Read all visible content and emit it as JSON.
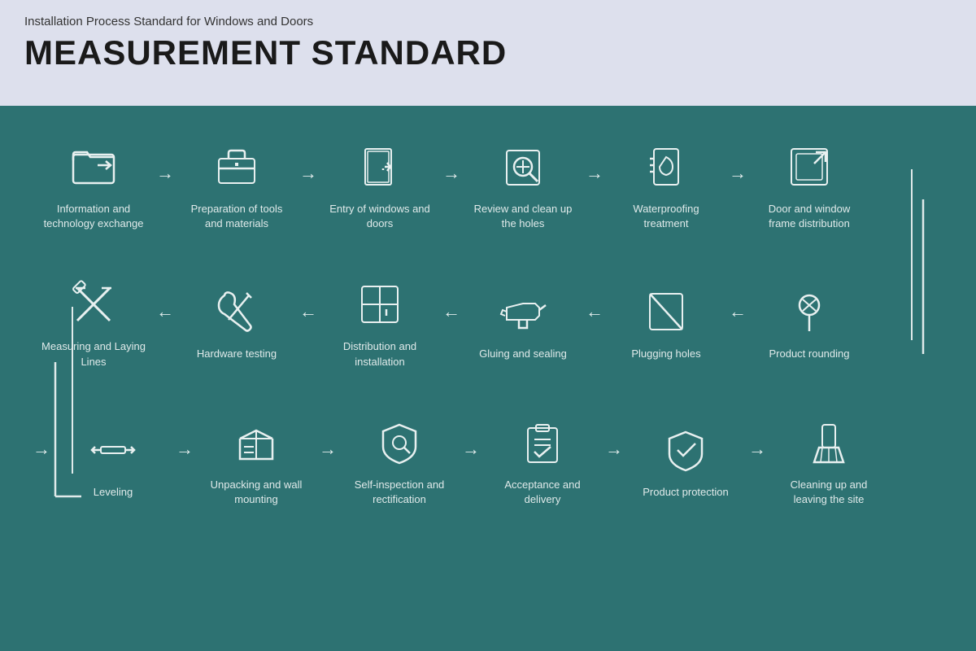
{
  "header": {
    "subtitle": "Installation Process Standard for Windows and Doors",
    "title": "MEASUREMENT STANDARD"
  },
  "rows": [
    {
      "direction": "ltr",
      "steps": [
        {
          "id": "info-exchange",
          "label": "Information and technology exchange",
          "icon": "folder"
        },
        {
          "id": "tools-prep",
          "label": "Preparation of tools and materials",
          "icon": "toolbox"
        },
        {
          "id": "entry-windows",
          "label": "Entry of windows and doors",
          "icon": "door-enter"
        },
        {
          "id": "review-holes",
          "label": "Review and clean up the holes",
          "icon": "magnify"
        },
        {
          "id": "waterproofing",
          "label": "Waterproofing treatment",
          "icon": "waterproof"
        },
        {
          "id": "frame-dist",
          "label": "Door and window frame distribution",
          "icon": "frame-export"
        }
      ]
    },
    {
      "direction": "rtl",
      "steps": [
        {
          "id": "measuring",
          "label": "Measuring and Laying Lines",
          "icon": "ruler-cross"
        },
        {
          "id": "hardware",
          "label": "Hardware testing",
          "icon": "wrench"
        },
        {
          "id": "distribution",
          "label": "Distribution and installation",
          "icon": "grid-window"
        },
        {
          "id": "gluing",
          "label": "Gluing and sealing",
          "icon": "glue-gun"
        },
        {
          "id": "plugging",
          "label": "Plugging holes",
          "icon": "plug-holes"
        },
        {
          "id": "rounding",
          "label": "Product rounding",
          "icon": "pin"
        }
      ]
    },
    {
      "direction": "ltr",
      "steps": [
        {
          "id": "leveling",
          "label": "Leveling",
          "icon": "level"
        },
        {
          "id": "unpacking",
          "label": "Unpacking and wall mounting",
          "icon": "unpack"
        },
        {
          "id": "self-inspect",
          "label": "Self-inspection and rectification",
          "icon": "self-inspect"
        },
        {
          "id": "acceptance",
          "label": "Acceptance and delivery",
          "icon": "accept"
        },
        {
          "id": "product-protect",
          "label": "Product protection",
          "icon": "shield"
        },
        {
          "id": "cleanup",
          "label": "Cleaning up and leaving the site",
          "icon": "broom"
        }
      ]
    }
  ]
}
